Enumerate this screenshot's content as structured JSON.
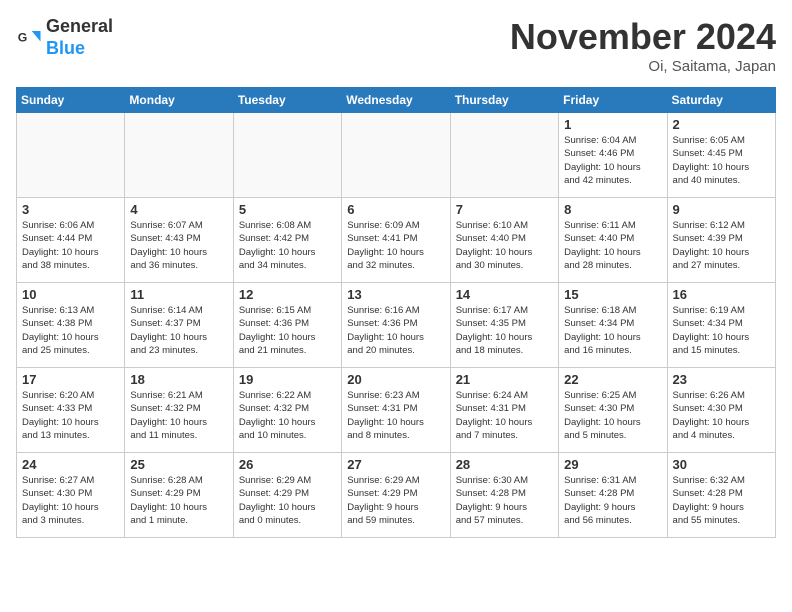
{
  "header": {
    "logo_line1": "General",
    "logo_line2": "Blue",
    "month": "November 2024",
    "location": "Oi, Saitama, Japan"
  },
  "days_of_week": [
    "Sunday",
    "Monday",
    "Tuesday",
    "Wednesday",
    "Thursday",
    "Friday",
    "Saturday"
  ],
  "weeks": [
    [
      {
        "day": "",
        "empty": true
      },
      {
        "day": "",
        "empty": true
      },
      {
        "day": "",
        "empty": true
      },
      {
        "day": "",
        "empty": true
      },
      {
        "day": "",
        "empty": true
      },
      {
        "day": "1",
        "lines": [
          "Sunrise: 6:04 AM",
          "Sunset: 4:46 PM",
          "Daylight: 10 hours",
          "and 42 minutes."
        ]
      },
      {
        "day": "2",
        "lines": [
          "Sunrise: 6:05 AM",
          "Sunset: 4:45 PM",
          "Daylight: 10 hours",
          "and 40 minutes."
        ]
      }
    ],
    [
      {
        "day": "3",
        "lines": [
          "Sunrise: 6:06 AM",
          "Sunset: 4:44 PM",
          "Daylight: 10 hours",
          "and 38 minutes."
        ]
      },
      {
        "day": "4",
        "lines": [
          "Sunrise: 6:07 AM",
          "Sunset: 4:43 PM",
          "Daylight: 10 hours",
          "and 36 minutes."
        ]
      },
      {
        "day": "5",
        "lines": [
          "Sunrise: 6:08 AM",
          "Sunset: 4:42 PM",
          "Daylight: 10 hours",
          "and 34 minutes."
        ]
      },
      {
        "day": "6",
        "lines": [
          "Sunrise: 6:09 AM",
          "Sunset: 4:41 PM",
          "Daylight: 10 hours",
          "and 32 minutes."
        ]
      },
      {
        "day": "7",
        "lines": [
          "Sunrise: 6:10 AM",
          "Sunset: 4:40 PM",
          "Daylight: 10 hours",
          "and 30 minutes."
        ]
      },
      {
        "day": "8",
        "lines": [
          "Sunrise: 6:11 AM",
          "Sunset: 4:40 PM",
          "Daylight: 10 hours",
          "and 28 minutes."
        ]
      },
      {
        "day": "9",
        "lines": [
          "Sunrise: 6:12 AM",
          "Sunset: 4:39 PM",
          "Daylight: 10 hours",
          "and 27 minutes."
        ]
      }
    ],
    [
      {
        "day": "10",
        "lines": [
          "Sunrise: 6:13 AM",
          "Sunset: 4:38 PM",
          "Daylight: 10 hours",
          "and 25 minutes."
        ]
      },
      {
        "day": "11",
        "lines": [
          "Sunrise: 6:14 AM",
          "Sunset: 4:37 PM",
          "Daylight: 10 hours",
          "and 23 minutes."
        ]
      },
      {
        "day": "12",
        "lines": [
          "Sunrise: 6:15 AM",
          "Sunset: 4:36 PM",
          "Daylight: 10 hours",
          "and 21 minutes."
        ]
      },
      {
        "day": "13",
        "lines": [
          "Sunrise: 6:16 AM",
          "Sunset: 4:36 PM",
          "Daylight: 10 hours",
          "and 20 minutes."
        ]
      },
      {
        "day": "14",
        "lines": [
          "Sunrise: 6:17 AM",
          "Sunset: 4:35 PM",
          "Daylight: 10 hours",
          "and 18 minutes."
        ]
      },
      {
        "day": "15",
        "lines": [
          "Sunrise: 6:18 AM",
          "Sunset: 4:34 PM",
          "Daylight: 10 hours",
          "and 16 minutes."
        ]
      },
      {
        "day": "16",
        "lines": [
          "Sunrise: 6:19 AM",
          "Sunset: 4:34 PM",
          "Daylight: 10 hours",
          "and 15 minutes."
        ]
      }
    ],
    [
      {
        "day": "17",
        "lines": [
          "Sunrise: 6:20 AM",
          "Sunset: 4:33 PM",
          "Daylight: 10 hours",
          "and 13 minutes."
        ]
      },
      {
        "day": "18",
        "lines": [
          "Sunrise: 6:21 AM",
          "Sunset: 4:32 PM",
          "Daylight: 10 hours",
          "and 11 minutes."
        ]
      },
      {
        "day": "19",
        "lines": [
          "Sunrise: 6:22 AM",
          "Sunset: 4:32 PM",
          "Daylight: 10 hours",
          "and 10 minutes."
        ]
      },
      {
        "day": "20",
        "lines": [
          "Sunrise: 6:23 AM",
          "Sunset: 4:31 PM",
          "Daylight: 10 hours",
          "and 8 minutes."
        ]
      },
      {
        "day": "21",
        "lines": [
          "Sunrise: 6:24 AM",
          "Sunset: 4:31 PM",
          "Daylight: 10 hours",
          "and 7 minutes."
        ]
      },
      {
        "day": "22",
        "lines": [
          "Sunrise: 6:25 AM",
          "Sunset: 4:30 PM",
          "Daylight: 10 hours",
          "and 5 minutes."
        ]
      },
      {
        "day": "23",
        "lines": [
          "Sunrise: 6:26 AM",
          "Sunset: 4:30 PM",
          "Daylight: 10 hours",
          "and 4 minutes."
        ]
      }
    ],
    [
      {
        "day": "24",
        "lines": [
          "Sunrise: 6:27 AM",
          "Sunset: 4:30 PM",
          "Daylight: 10 hours",
          "and 3 minutes."
        ]
      },
      {
        "day": "25",
        "lines": [
          "Sunrise: 6:28 AM",
          "Sunset: 4:29 PM",
          "Daylight: 10 hours",
          "and 1 minute."
        ]
      },
      {
        "day": "26",
        "lines": [
          "Sunrise: 6:29 AM",
          "Sunset: 4:29 PM",
          "Daylight: 10 hours",
          "and 0 minutes."
        ]
      },
      {
        "day": "27",
        "lines": [
          "Sunrise: 6:29 AM",
          "Sunset: 4:29 PM",
          "Daylight: 9 hours",
          "and 59 minutes."
        ]
      },
      {
        "day": "28",
        "lines": [
          "Sunrise: 6:30 AM",
          "Sunset: 4:28 PM",
          "Daylight: 9 hours",
          "and 57 minutes."
        ]
      },
      {
        "day": "29",
        "lines": [
          "Sunrise: 6:31 AM",
          "Sunset: 4:28 PM",
          "Daylight: 9 hours",
          "and 56 minutes."
        ]
      },
      {
        "day": "30",
        "lines": [
          "Sunrise: 6:32 AM",
          "Sunset: 4:28 PM",
          "Daylight: 9 hours",
          "and 55 minutes."
        ]
      }
    ]
  ]
}
